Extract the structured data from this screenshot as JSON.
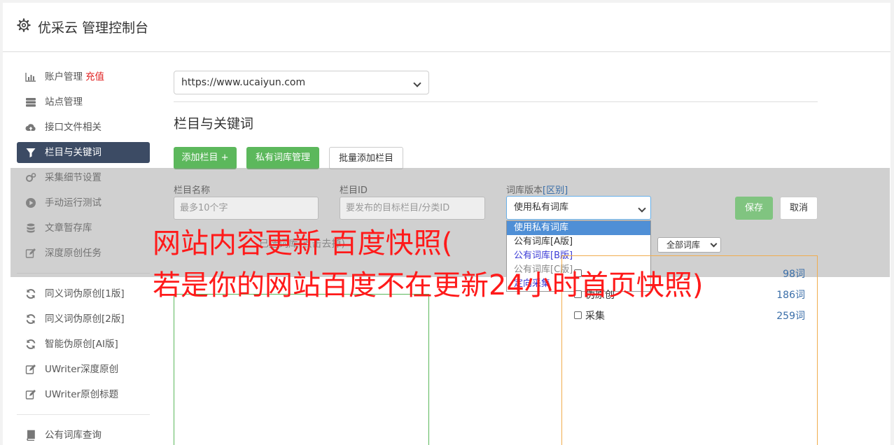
{
  "app": {
    "title": "优采云 管理控制台",
    "icon": "gear-icon"
  },
  "sidebar": {
    "items": [
      {
        "label": "账户管理",
        "badge": "充值",
        "icon": "bar-chart-icon"
      },
      {
        "label": "站点管理",
        "icon": "server-icon"
      },
      {
        "label": "接口文件相关",
        "icon": "cloud-upload-icon"
      },
      {
        "label": "栏目与关键词",
        "icon": "filter-icon",
        "active": true
      },
      {
        "label": "采集细节设置",
        "icon": "cogs-icon"
      },
      {
        "label": "手动运行测试",
        "icon": "play-circle-icon"
      },
      {
        "label": "文章暂存库",
        "icon": "database-icon"
      },
      {
        "label": "深度原创任务",
        "icon": "edit-icon"
      }
    ],
    "items2": [
      {
        "label": "同义词伪原创[1版]",
        "icon": "refresh-icon"
      },
      {
        "label": "同义词伪原创[2版]",
        "icon": "refresh-icon"
      },
      {
        "label": "智能伪原创[AI版]",
        "icon": "refresh-icon"
      },
      {
        "label": "UWriter深度原创",
        "icon": "edit-icon"
      },
      {
        "label": "UWriter原创标题",
        "icon": "edit-icon"
      }
    ],
    "items3": [
      {
        "label": "公有词库查询",
        "icon": "book-icon"
      }
    ]
  },
  "main": {
    "site_select": {
      "value": "https://www.ucaiyun.com"
    },
    "section_title": "栏目与关键词",
    "buttons": {
      "add_column": "添加栏目 +",
      "private_lib": "私有词库管理",
      "batch_add": "批量添加栏目"
    },
    "form": {
      "name_label": "栏目名称",
      "name_placeholder": "最多10个字",
      "id_label": "栏目ID",
      "id_placeholder": "要发布的目标栏目/分类ID",
      "version_label": "词库版本",
      "version_link": "[区别]",
      "version_value": "使用私有词库",
      "version_options": [
        "使用私有词库",
        "公有词库[A版]",
        "公有词库[B版]",
        "公有词库[C版]",
        "定向采集"
      ],
      "save": "保存",
      "cancel": "取消"
    },
    "hint": "已选词库(点击去掉)",
    "lib_filter": "全部词库",
    "libraries": [
      {
        "name": "",
        "count": "98词"
      },
      {
        "name": "伪原创",
        "count": "186词"
      },
      {
        "name": "采集",
        "count": "259词"
      }
    ]
  },
  "watermark": {
    "line1": "网站内容更新 百度快照(",
    "line2": "若是你的网站百度不在更新24小时首页快照)"
  },
  "colors": {
    "accent_green": "#5cb85c",
    "nav_active": "#3c4b64",
    "link_blue": "#3a6ea8",
    "watermark_red": "#ff1a1a"
  }
}
